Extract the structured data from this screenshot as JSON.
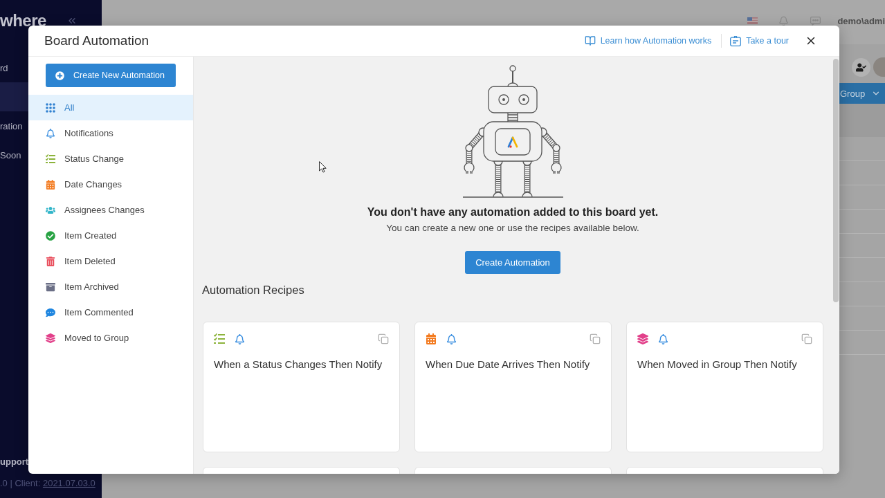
{
  "background_app": {
    "sidebar": {
      "logo": "where",
      "items": [
        {
          "label": "rd",
          "selected": false
        },
        {
          "selected": true
        },
        {
          "label": "ration",
          "selected": false
        },
        {
          "label": "Soon",
          "selected": false
        }
      ],
      "support_label": "upport",
      "version": {
        "text": ".0 | Client:",
        "link": "2021.07.03.0"
      }
    },
    "topbar": {
      "user": "demo\\admi"
    },
    "toolbar": {
      "group_button": "Group"
    }
  },
  "modal": {
    "title": "Board Automation",
    "header_links": [
      {
        "kind": "book",
        "label": "Learn how Automation works"
      },
      {
        "kind": "tour",
        "label": "Take a tour"
      }
    ],
    "sidebar": {
      "create_button": "Create New Automation",
      "items": [
        {
          "kind": "all",
          "label": "All",
          "selected": true,
          "color": "#2f80d0"
        },
        {
          "kind": "notifications",
          "label": "Notifications",
          "selected": false,
          "color": "#3b8fe0"
        },
        {
          "kind": "status",
          "label": "Status Change",
          "selected": false,
          "color": "#8cb33b"
        },
        {
          "kind": "date",
          "label": "Date Changes",
          "selected": false,
          "color": "#f37b20"
        },
        {
          "kind": "assignees",
          "label": "Assignees Changes",
          "selected": false,
          "color": "#32b5c9"
        },
        {
          "kind": "created",
          "label": "Item Created",
          "selected": false,
          "color": "#27a243"
        },
        {
          "kind": "deleted",
          "label": "Item Deleted",
          "selected": false,
          "color": "#e9505e"
        },
        {
          "kind": "archived",
          "label": "Item Archived",
          "selected": false,
          "color": "#6b6f86"
        },
        {
          "kind": "commented",
          "label": "Item Commented",
          "selected": false,
          "color": "#1f86e0"
        },
        {
          "kind": "group",
          "label": "Moved to Group",
          "selected": false,
          "color": "#e2408a"
        }
      ]
    },
    "empty_state": {
      "heading": "You don't have any automation added to this board yet.",
      "text": "You can create a new one or use the recipes available below.",
      "button": "Create Automation"
    },
    "recipes": {
      "title": "Automation Recipes",
      "cards": [
        {
          "kind": "status",
          "color": "#8cb33b",
          "title": "When a Status Changes Then Notify",
          "cut_off": false
        },
        {
          "kind": "date",
          "color": "#f37b20",
          "title": "When Due Date Arrives Then Notify",
          "cut_off": false
        },
        {
          "kind": "group",
          "color": "#e2408a",
          "title": "When Moved in Group Then Notify",
          "cut_off": false
        },
        {
          "cut_off": true
        },
        {
          "cut_off": true
        },
        {
          "cut_off": true
        }
      ]
    }
  }
}
